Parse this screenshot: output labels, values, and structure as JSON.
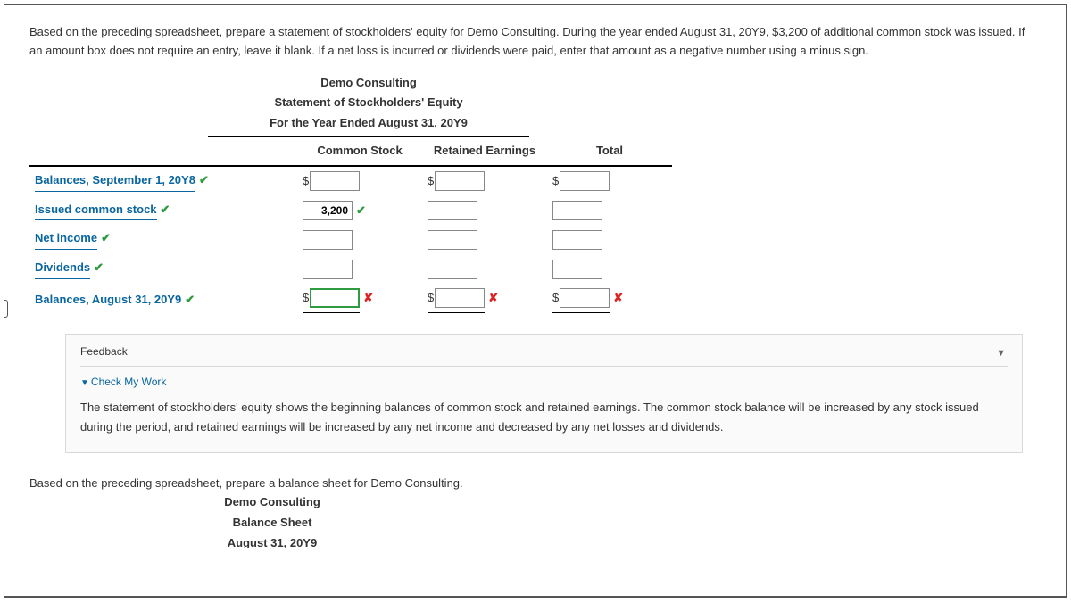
{
  "instructions_1": "Based on the preceding spreadsheet, prepare a statement of stockholders' equity for Demo Consulting. During the year ended August 31, 20Y9, $3,200 of additional common stock was issued. If an amount box does not require an entry, leave it blank. If a net loss is incurred or dividends were paid, enter that amount as a negative number using a minus sign.",
  "stmt": {
    "company": "Demo Consulting",
    "title": "Statement of Stockholders' Equity",
    "period": "For the Year Ended August 31, 20Y9",
    "col1": "Common Stock",
    "col2": "Retained Earnings",
    "col3": "Total"
  },
  "rows": [
    {
      "label": "Balances, September 1, 20Y8",
      "mark": "✔",
      "dollar": true,
      "cs": "",
      "re": "",
      "tot": "",
      "cs_mark": "",
      "re_mark": "",
      "tot_mark": ""
    },
    {
      "label": "Issued common stock",
      "mark": "✔",
      "dollar": false,
      "cs": "3,200",
      "re": "",
      "tot": "",
      "cs_mark": "✔",
      "re_mark": "",
      "tot_mark": ""
    },
    {
      "label": "Net income",
      "mark": "✔",
      "dollar": false,
      "cs": "",
      "re": "",
      "tot": "",
      "cs_mark": "",
      "re_mark": "",
      "tot_mark": ""
    },
    {
      "label": "Dividends",
      "mark": "✔",
      "dollar": false,
      "cs": "",
      "re": "",
      "tot": "",
      "cs_mark": "",
      "re_mark": "",
      "tot_mark": ""
    },
    {
      "label": "Balances, August 31, 20Y9",
      "mark": "✔",
      "dollar": true,
      "cs": "",
      "re": "",
      "tot": "",
      "cs_mark": "✘",
      "re_mark": "✘",
      "tot_mark": "✘",
      "dbl": true,
      "hl": true
    }
  ],
  "feedback_label": "Feedback",
  "check_my_work": "Check My Work",
  "feedback_text": "The statement of stockholders' equity shows the beginning balances of common stock and retained earnings. The common stock balance will be increased by any stock issued during the period, and retained earnings will be increased by any net income and decreased by any net losses and dividends.",
  "instructions_2": "Based on the preceding spreadsheet, prepare a balance sheet for Demo Consulting.",
  "bs": {
    "company": "Demo Consulting",
    "title": "Balance Sheet",
    "date": "August 31, 20Y9"
  }
}
